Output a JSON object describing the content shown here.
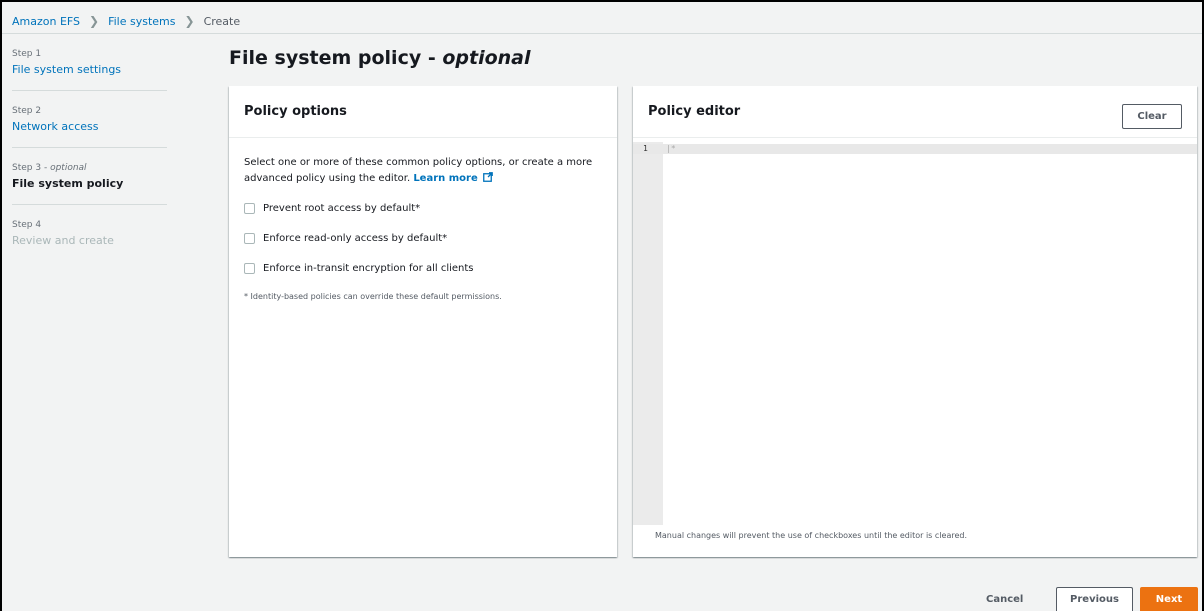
{
  "breadcrumb": {
    "items": [
      "Amazon EFS",
      "File systems"
    ],
    "current": "Create"
  },
  "steps": [
    {
      "num": "Step 1",
      "title": "File system settings"
    },
    {
      "num": "Step 2",
      "title": "Network access"
    },
    {
      "num": "Step 3",
      "num_suffix": "optional",
      "title": "File system policy"
    },
    {
      "num": "Step 4",
      "title": "Review and create"
    }
  ],
  "page": {
    "title": "File system policy",
    "title_suffix": "optional"
  },
  "policy_options": {
    "title": "Policy options",
    "description": "Select one or more of these common policy options, or create a more advanced policy using the editor.",
    "learn_more": "Learn more",
    "options": [
      "Prevent root access by default*",
      "Enforce read-only access by default*",
      "Enforce in-transit encryption for all clients"
    ],
    "footnote": "* Identity-based policies can override these default permissions."
  },
  "policy_editor": {
    "title": "Policy editor",
    "clear_label": "Clear",
    "line_number": "1",
    "content": "|*",
    "note": "Manual changes will prevent the use of checkboxes until the editor is cleared."
  },
  "actions": {
    "cancel": "Cancel",
    "previous": "Previous",
    "next": "Next"
  },
  "colors": {
    "link": "#0073bb",
    "primary": "#ec7211",
    "background": "#f2f3f3"
  }
}
